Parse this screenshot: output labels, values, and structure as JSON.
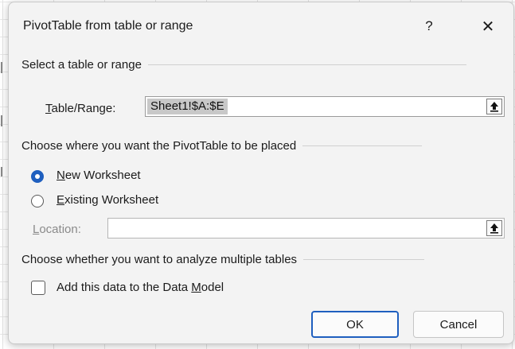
{
  "dialog": {
    "title": "PivotTable from table or range",
    "help_label": "?",
    "close_label": "✕"
  },
  "section_select": {
    "label": "Select a table or range",
    "table_range_label_accel": "T",
    "table_range_label_rest": "able/Range:",
    "table_range_value": "Sheet1!$A:$E"
  },
  "section_place": {
    "label": "Choose where you want the PivotTable to be placed",
    "options": [
      {
        "accel": "N",
        "rest": "ew Worksheet",
        "checked": true
      },
      {
        "accel": "E",
        "rest": "xisting Worksheet",
        "checked": false
      }
    ],
    "location_label_accel": "L",
    "location_label_rest": "ocation:",
    "location_value": ""
  },
  "section_multi": {
    "label": "Choose whether you want to analyze multiple tables",
    "checkbox_label_before": "Add this data to the Data ",
    "checkbox_label_accel": "M",
    "checkbox_label_after": "odel",
    "checked": false
  },
  "buttons": {
    "ok": "OK",
    "cancel": "Cancel"
  },
  "icons": {
    "collapse": "collapse-dialog-arrow-up-icon"
  },
  "colors": {
    "accent": "#1f5fbf",
    "dialog_bg": "#f3f3f3"
  }
}
